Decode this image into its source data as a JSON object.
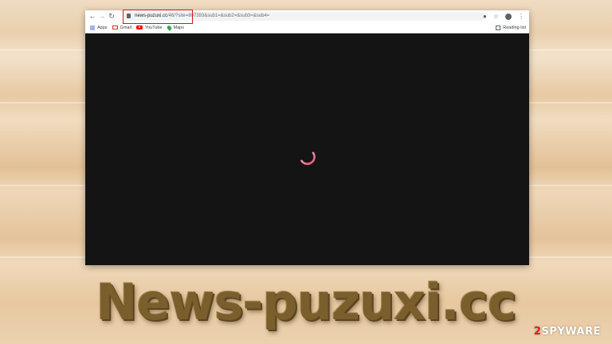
{
  "browser": {
    "url_host": "news-puzuxi.cc",
    "url_path": "/46/?site=807393&sub1=&sub2=&sub3=&sub4=",
    "bookmarks": [
      {
        "label": "Apps",
        "icon": "apps-icon"
      },
      {
        "label": "Gmail",
        "icon": "gmail-icon"
      },
      {
        "label": "YouTube",
        "icon": "youtube-icon"
      },
      {
        "label": "Maps",
        "icon": "maps-icon"
      }
    ],
    "reading_list": "Reading list"
  },
  "headline": "News-puzuxi.cc",
  "watermark": {
    "two": "2",
    "rest": "SPYWAR",
    "mark": "E"
  },
  "colors": {
    "highlight_box": "#d9141b",
    "page_background": "#141414",
    "spinner": "#e5507a",
    "headline": "#7a5e2c"
  }
}
